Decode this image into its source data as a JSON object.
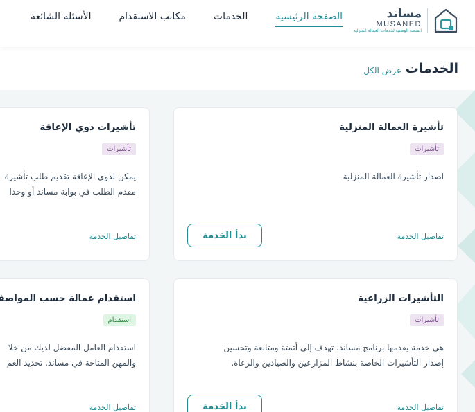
{
  "logo": {
    "arabic": "مساند",
    "english": "MUSANED",
    "tagline": "المنصة الوطنية لخدمات العمالة المنزلية"
  },
  "nav": [
    {
      "label": "الصفحة الرئيسية",
      "active": true
    },
    {
      "label": "الخدمات",
      "active": false
    },
    {
      "label": "مكاتب الاستقدام",
      "active": false
    },
    {
      "label": "الأسئلة الشائعة",
      "active": false
    }
  ],
  "section": {
    "title": "الخدمات",
    "view_all": "عرض الكل"
  },
  "cards": [
    {
      "title": "تأشيرة العمالة المنزلية",
      "badge": "تأشيرات",
      "desc": [
        "اصدار تأشيرة العمالة المنزلية"
      ],
      "details": "تفاصيل الخدمة",
      "start": "بدأ الخدمة"
    },
    {
      "title": "تأشيرات ذوي الإعاقة",
      "badge": "تأشيرات",
      "desc": [
        "يمكن لذوي الإعاقة تقديم طلب تأشيرة",
        "مقدم الطلب في بوابة مساند أو وحدا"
      ],
      "details": "تفاصيل الخدمة"
    },
    {
      "title": "التأشيرات الزراعية",
      "badge": "تأشيرات",
      "desc": [
        "هي خدمة يقدمها برنامج مساند، تهدف إلى أتمتة ومتابعة وتحسين",
        "إصدار التأشيرات الخاصة بنشاط المزارعين والصيادين والرعاة."
      ],
      "details": "تفاصيل الخدمة",
      "start": "بدأ الخدمة"
    },
    {
      "title": "استقدام عمالة حسب المواصفات",
      "badge": "استقدام",
      "desc": [
        "استقدام العامل المفضل لديك من خلا",
        "والمهن المتاحة في مساند. تحديد العم"
      ],
      "details": "تفاصيل الخدمة"
    }
  ],
  "colors": {
    "accent": "#1f8d92",
    "visa_badge_bg": "#ede3f1",
    "visa_badge_fg": "#7a4d8c",
    "rec_badge_bg": "#dff5e3",
    "rec_badge_fg": "#2f8a43"
  }
}
